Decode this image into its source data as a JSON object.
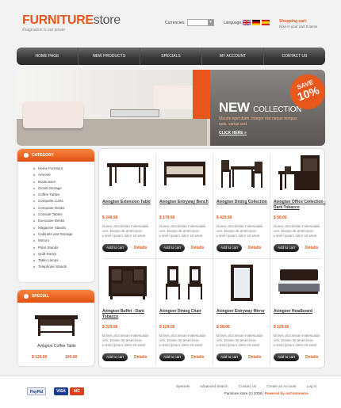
{
  "brand": {
    "name_bold": "FURNITURE",
    "name_rest": "store",
    "tagline": "imagination is our power"
  },
  "header": {
    "currencies_label": "Currencies:",
    "language_label": "Language:",
    "flags": [
      "uk-flag-icon",
      "germany-flag-icon",
      "spain-flag-icon"
    ],
    "cart_title": "Shopping cart:",
    "cart_text": "Now in your cart 0 items"
  },
  "nav": [
    "HOME PAGE",
    "NEW PRODUCTS",
    "SPECIALS",
    "MY ACCOUNT",
    "CONTACT US"
  ],
  "banner": {
    "title_big": "NEW",
    "title_small": "COLLECTION",
    "text": "Mauris eget diam. Integer nisi neque tempus quis, varius sed.",
    "click_here": "CLICK HERE",
    "badge_top": "SAVE",
    "badge_value": "10%"
  },
  "category": {
    "title": "CATEGORY",
    "items": [
      "Home Furniture",
      "Armoire",
      "Bookcases",
      "Closet Storage",
      "Coffee Tables",
      "Computer Carts",
      "Computer Desks",
      "Console Tables",
      "Executive Desks",
      "Magazine Stands",
      "Cabinets and Storage",
      "Mirrors",
      "Plant Stands",
      "Quilt Racks",
      "Table Lamps",
      "Telephone Stands"
    ]
  },
  "special": {
    "title": "SPECIAL",
    "name": "Avington Coffee Table",
    "old_price": "$ 120.00",
    "new_price": "100.00"
  },
  "products": [
    {
      "name": "Avington Extension Table",
      "price": "$ 249.99",
      "desc": "Donec accumsan malesuada orci. Donec sit amet eros. Lorem ipsum dolor sit amet",
      "icon": "dining-table-icon"
    },
    {
      "name": "Avington Entryway Bench",
      "price": "$ 179.99",
      "desc": "Donec accumsan malesuada orci. Donec sit amet eros. Lorem ipsum dolor sit amet",
      "icon": "bench-icon"
    },
    {
      "name": "Avington Dining Collection",
      "price": "$ 429.99",
      "desc": "Donec accumsan malesuada orci. Donec sit amet eros. Lorem ipsum dolor sit amet",
      "icon": "dining-set-icon"
    },
    {
      "name": "Avington Office Collection - Dark Tobacco",
      "price": "$ 58.00",
      "desc": "Donec accumsan malesuada orci. Donec sit amet eros. Lorem ipsum dolor sit amet",
      "icon": "office-desk-icon"
    },
    {
      "name": "Avington Buffet - Dark Tobacco",
      "price": "$ 229.56",
      "desc": "Donec accumsan malesuada orci. Donec sit amet eros. Lorem ipsum dolor sit amet",
      "icon": "buffet-icon"
    },
    {
      "name": "Avington Dining Chair",
      "price": "$ 129.00",
      "desc": "Donec accumsan malesuada orci. Donec sit amet eros. Lorem ipsum dolor sit amet",
      "icon": "chairs-icon"
    },
    {
      "name": "Avington Entryway Mirror",
      "price": "$ 58.00",
      "desc": "Donec accumsan malesuada orci. Donec sit amet eros. Lorem ipsum dolor sit amet",
      "icon": "mirror-icon"
    },
    {
      "name": "Avington Headboard",
      "price": "$ 129.56",
      "desc": "Donec accumsan malesuada orci. Donec sit amet eros. Lorem ipsum dolor sit amet",
      "icon": "bed-icon"
    }
  ],
  "product_buttons": {
    "add": "Add to cart",
    "details": "Details"
  },
  "footer": {
    "links": [
      "Specials",
      "Advanced Search",
      "Contact Us",
      "Create an Account",
      "Log In"
    ],
    "copy": "Furniture store (c) 2008",
    "powered": "Powered by osCommerce",
    "payments": [
      "PayPal",
      "VISA",
      "MC"
    ]
  },
  "colors": {
    "accent": "#e8581c",
    "nav": "#3a3a3a"
  }
}
